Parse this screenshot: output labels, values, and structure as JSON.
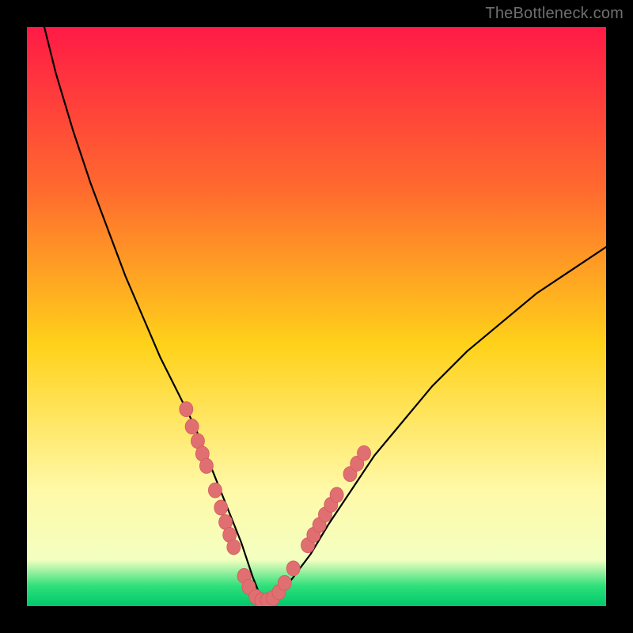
{
  "watermark": "TheBottleneck.com",
  "colors": {
    "frame": "#000000",
    "curve": "#000000",
    "marker_fill": "#e06f72",
    "marker_stroke": "#d55a5d",
    "grad_top": "#ff1a46",
    "grad_mid1": "#ff6a2e",
    "grad_mid2": "#ffd21a",
    "grad_mid3": "#fff9a8",
    "grad_low": "#f3ffc0",
    "grad_green": "#2fe07a",
    "grad_bottom": "#00c86a"
  },
  "chart_data": {
    "type": "line",
    "title": "",
    "xlabel": "",
    "ylabel": "",
    "xlim": [
      0,
      100
    ],
    "ylim": [
      0,
      100
    ],
    "grid": false,
    "legend": false,
    "annotations": [
      "TheBottleneck.com"
    ],
    "series": [
      {
        "name": "bottleneck-curve",
        "x": [
          0,
          2,
          5,
          8,
          11,
          14,
          17,
          20,
          23,
          26,
          29,
          31,
          33,
          35,
          37,
          38,
          39,
          40,
          41,
          42,
          44,
          46,
          49,
          52,
          56,
          60,
          65,
          70,
          76,
          82,
          88,
          94,
          100
        ],
        "y": [
          115,
          104,
          92,
          82,
          73,
          65,
          57,
          50,
          43,
          37,
          31,
          26,
          21,
          16,
          11,
          8,
          5,
          2.5,
          1,
          1,
          2.5,
          5,
          9,
          14,
          20,
          26,
          32,
          38,
          44,
          49,
          54,
          58,
          62
        ]
      }
    ],
    "markers": [
      {
        "x": 27.5,
        "y": 34
      },
      {
        "x": 28.5,
        "y": 31
      },
      {
        "x": 29.5,
        "y": 28.5
      },
      {
        "x": 30.3,
        "y": 26.3
      },
      {
        "x": 31,
        "y": 24.2
      },
      {
        "x": 32.5,
        "y": 20
      },
      {
        "x": 33.5,
        "y": 17
      },
      {
        "x": 34.3,
        "y": 14.5
      },
      {
        "x": 35,
        "y": 12.3
      },
      {
        "x": 35.7,
        "y": 10.2
      },
      {
        "x": 37.5,
        "y": 5.2
      },
      {
        "x": 38.3,
        "y": 3.3
      },
      {
        "x": 39.5,
        "y": 1.6
      },
      {
        "x": 40.5,
        "y": 1
      },
      {
        "x": 41.5,
        "y": 1
      },
      {
        "x": 42.5,
        "y": 1.4
      },
      {
        "x": 43.5,
        "y": 2.4
      },
      {
        "x": 44.5,
        "y": 4
      },
      {
        "x": 46,
        "y": 6.5
      },
      {
        "x": 48.5,
        "y": 10.5
      },
      {
        "x": 49.5,
        "y": 12.3
      },
      {
        "x": 50.5,
        "y": 14
      },
      {
        "x": 51.5,
        "y": 15.8
      },
      {
        "x": 52.5,
        "y": 17.5
      },
      {
        "x": 53.5,
        "y": 19.2
      },
      {
        "x": 55.8,
        "y": 22.8
      },
      {
        "x": 57,
        "y": 24.6
      },
      {
        "x": 58.2,
        "y": 26.4
      }
    ]
  }
}
